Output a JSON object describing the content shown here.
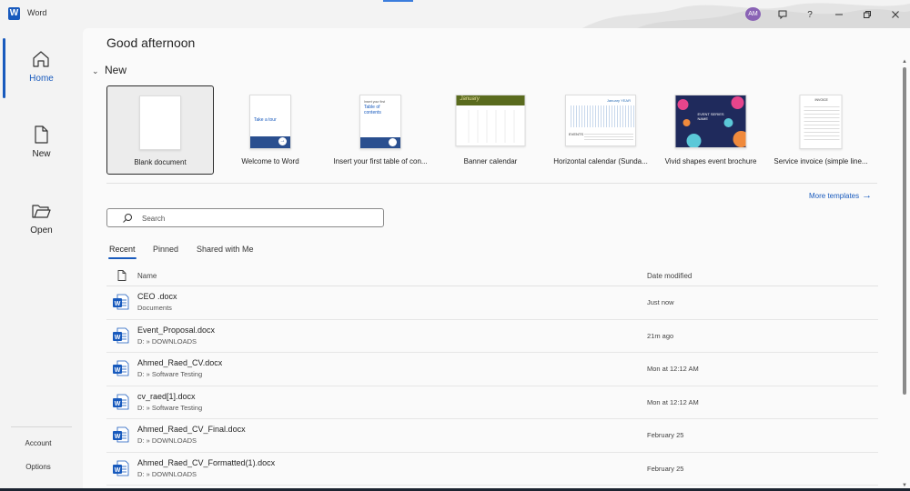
{
  "app": {
    "title": "Word",
    "icon": "word-app-icon",
    "accent": "#185abd"
  },
  "titlebar": {
    "avatar_initials": "AM",
    "avatar_color": "#8a63b5",
    "icons": [
      "feedback-icon",
      "help-icon",
      "minimize-icon",
      "restore-icon",
      "close-icon"
    ],
    "help_label": "?"
  },
  "sidebar": {
    "items": [
      {
        "label": "Home",
        "icon": "home-icon",
        "active": true
      },
      {
        "label": "New",
        "icon": "new-document-icon",
        "active": false
      },
      {
        "label": "Open",
        "icon": "folder-open-icon",
        "active": false
      }
    ],
    "bottom": [
      {
        "label": "Account"
      },
      {
        "label": "Options"
      }
    ]
  },
  "main": {
    "greeting": "Good afternoon",
    "new_section_title": "New",
    "templates": [
      {
        "label": "Blank document",
        "selected": true
      },
      {
        "label": "Welcome to Word",
        "thumb_text": "Take a tour"
      },
      {
        "label": "Insert your first table of con...",
        "thumb_small": "Insert your first",
        "thumb_text": "Table of contents"
      },
      {
        "label": "Banner calendar",
        "thumb_text": "January"
      },
      {
        "label": "Horizontal calendar (Sunda...",
        "thumb_text": "January YEAR",
        "thumb_small": "EVENTS"
      },
      {
        "label": "Vivid shapes event brochure",
        "thumb_text": "EVENT SERIES NAME"
      },
      {
        "label": "Service invoice (simple line...",
        "thumb_text": "INVOICE"
      }
    ],
    "more_templates": "More templates",
    "search": {
      "placeholder": "Search",
      "value": ""
    },
    "tabs": [
      {
        "label": "Recent",
        "active": true
      },
      {
        "label": "Pinned",
        "active": false
      },
      {
        "label": "Shared with Me",
        "active": false
      }
    ],
    "file_table": {
      "columns": {
        "name": "Name",
        "date": "Date modified"
      },
      "rows": [
        {
          "name": "CEO .docx",
          "path": "Documents",
          "date": "Just now"
        },
        {
          "name": "Event_Proposal.docx",
          "path": "D: » DOWNLOADS",
          "date": "21m ago"
        },
        {
          "name": "Ahmed_Raed_CV.docx",
          "path": "D: » Software Testing",
          "date": "Mon at 12:12 AM"
        },
        {
          "name": "cv_raed[1].docx",
          "path": "D: » Software Testing",
          "date": "Mon at 12:12 AM"
        },
        {
          "name": "Ahmed_Raed_CV_Final.docx",
          "path": "D: » DOWNLOADS",
          "date": "February 25"
        },
        {
          "name": "Ahmed_Raed_CV_Formatted(1).docx",
          "path": "D: » DOWNLOADS",
          "date": "February 25"
        }
      ]
    }
  }
}
